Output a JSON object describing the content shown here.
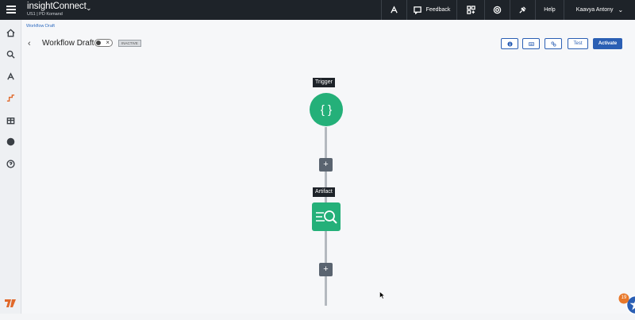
{
  "topbar": {
    "brand_prefix": "insight",
    "brand_name": "Connect",
    "org": "US1 | PD Komand",
    "feedback": "Feedback",
    "help": "Help",
    "user": "Kaavya Antony"
  },
  "breadcrumb": "Workflow Draft",
  "header": {
    "title": "Workflow Draft",
    "status": "INACTIVE",
    "test_label": "Test",
    "activate_label": "Activate"
  },
  "canvas": {
    "trigger_label": "Trigger",
    "trigger_glyph": "{ }",
    "artifact_label": "Artifact",
    "add_glyph": "+"
  },
  "notification_count": "19",
  "colors": {
    "accent": "#2b5fb4",
    "node": "#24b079",
    "topbar": "#1e2329"
  }
}
